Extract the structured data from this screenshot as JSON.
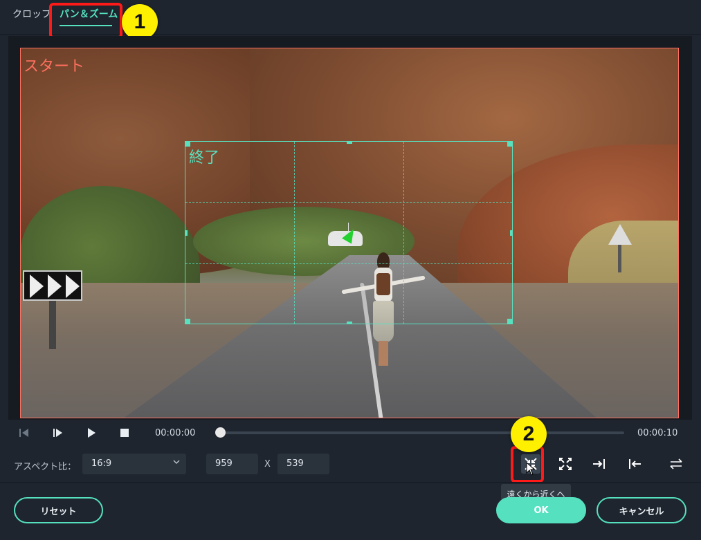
{
  "tabs": [
    {
      "label": "クロップ"
    },
    {
      "label": "パン＆ズーム"
    }
  ],
  "annotations": {
    "badge1": "1",
    "badge2": "2"
  },
  "preview": {
    "start_label": "スタート",
    "end_label": "終了"
  },
  "playback": {
    "current_time": "00:00:00",
    "total_time": "00:00:10",
    "progress": 0
  },
  "aspect": {
    "label": "アスペクト比：",
    "selected": "16:9",
    "width": "959",
    "separator": "X",
    "height": "539"
  },
  "tooltip": "遠くから近くへ",
  "buttons": {
    "reset": "リセット",
    "ok": "OK",
    "cancel": "キャンセル"
  },
  "colors": {
    "accent": "#55e1c0",
    "start_frame": "#ff6f5e",
    "highlight": "#ff1a1a",
    "badge": "#fff000"
  }
}
